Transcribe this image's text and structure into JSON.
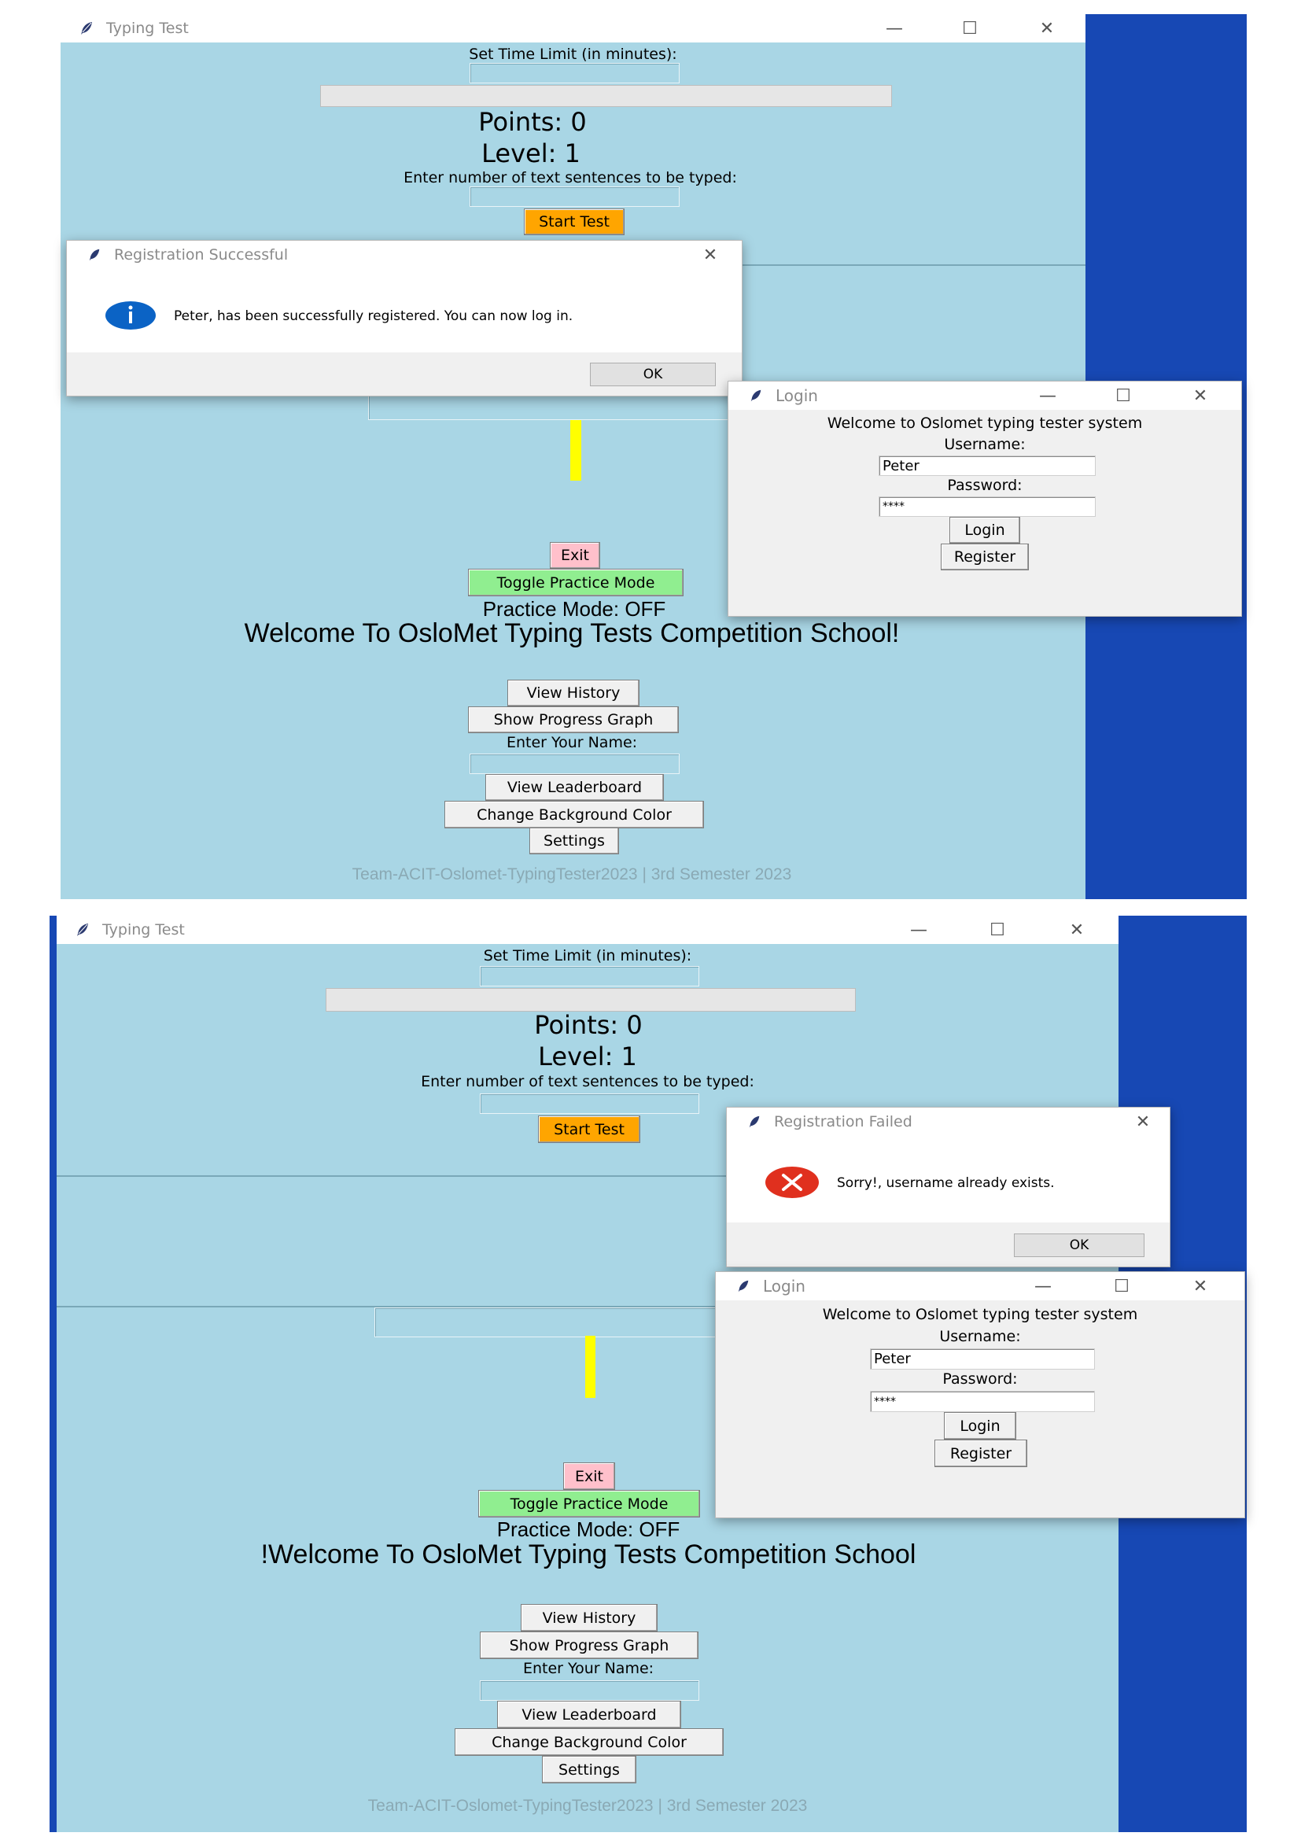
{
  "window_title": "Typing Test",
  "window_controls": {
    "minimize": "—",
    "maximize": "☐",
    "close": "✕"
  },
  "main": {
    "time_limit_label": "Set Time Limit (in minutes):",
    "points": "Points: 0",
    "level": "Level: 1",
    "sentences_label": "Enter number of text sentences to be typed:",
    "start_test": "Start Test",
    "exit": "Exit",
    "toggle_practice": "Toggle Practice Mode",
    "practice_mode": "Practice Mode: OFF",
    "welcome_top": "Welcome To OsloMet Typing Tests Competition School!",
    "welcome_bottom": "!Welcome To OsloMet Typing Tests Competition School",
    "view_history": "View History",
    "show_progress": "Show Progress Graph",
    "enter_name": "Enter Your Name:",
    "view_leaderboard": "View Leaderboard",
    "change_bg": "Change Background Color",
    "settings": "Settings",
    "footer": "Team-ACIT-Oslomet-TypingTester2023 | 3rd Semester 2023"
  },
  "dialog_success": {
    "title": "Registration Successful",
    "message": "Peter, has been successfully registered. You can now log in.",
    "ok": "OK",
    "icon": "info-icon"
  },
  "dialog_failed": {
    "title": "Registration Failed",
    "message": "Sorry!, username already exists.",
    "ok": "OK",
    "icon": "error-icon"
  },
  "login": {
    "title": "Login",
    "welcome": "Welcome to Oslomet typing tester system",
    "username_label": "Username:",
    "username_value": "Peter",
    "password_label": "Password:",
    "password_value": "****",
    "login_button": "Login",
    "register_button": "Register"
  },
  "colors": {
    "window_bg": "#a9d6e5",
    "desktop_bg": "#1748b4",
    "start_button": "#ffa500",
    "practice_button": "#90ee90",
    "exit_button": "#ffc0cb",
    "cursor_bar": "#ffff00"
  }
}
